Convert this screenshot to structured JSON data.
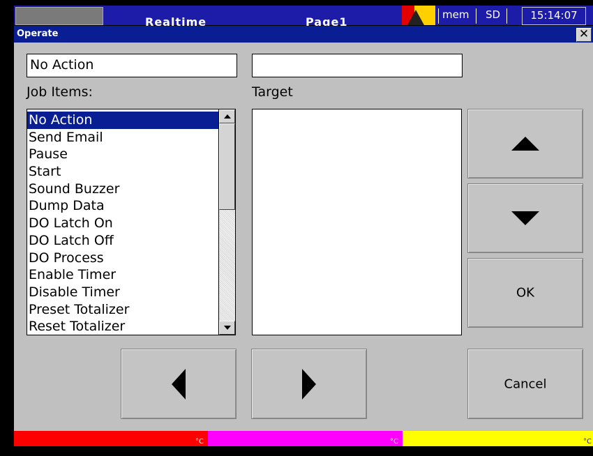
{
  "topbar": {
    "tabs": [
      "Realtime",
      "Page1"
    ],
    "status_mem": "mem",
    "status_sd": "SD",
    "time": "15:14:07",
    "colors": {
      "bar": "#1c1ca8",
      "alarm": "#ffd000"
    }
  },
  "dialog": {
    "title": "Operate",
    "close_icon": "close-icon",
    "selected_action_value": "No Action",
    "target_value": "",
    "job_items_label": "Job Items:",
    "target_label": "Target",
    "job_items": [
      "No Action",
      "Send Email",
      "Pause",
      "Start",
      "Sound Buzzer",
      "Dump Data",
      "DO Latch On",
      "DO Latch Off",
      "DO Process",
      "Enable Timer",
      "Disable Timer",
      "Preset Totalizer",
      "Reset Totalizer"
    ],
    "selected_index": 0,
    "buttons": {
      "move_up_icon": "arrow-up-icon",
      "move_down_icon": "arrow-down-icon",
      "ok": "OK",
      "prev_icon": "arrow-left-icon",
      "next_icon": "arrow-right-icon",
      "cancel": "Cancel"
    }
  },
  "channels": [
    {
      "unit": "°C",
      "color": "#ff0000",
      "value_color": "#1010c0"
    },
    {
      "unit": "°C",
      "color": "#ff00ff",
      "value_color": "#10a010"
    },
    {
      "unit": "°C",
      "color": "#ffff00",
      "value_color": "#1010c0"
    }
  ]
}
